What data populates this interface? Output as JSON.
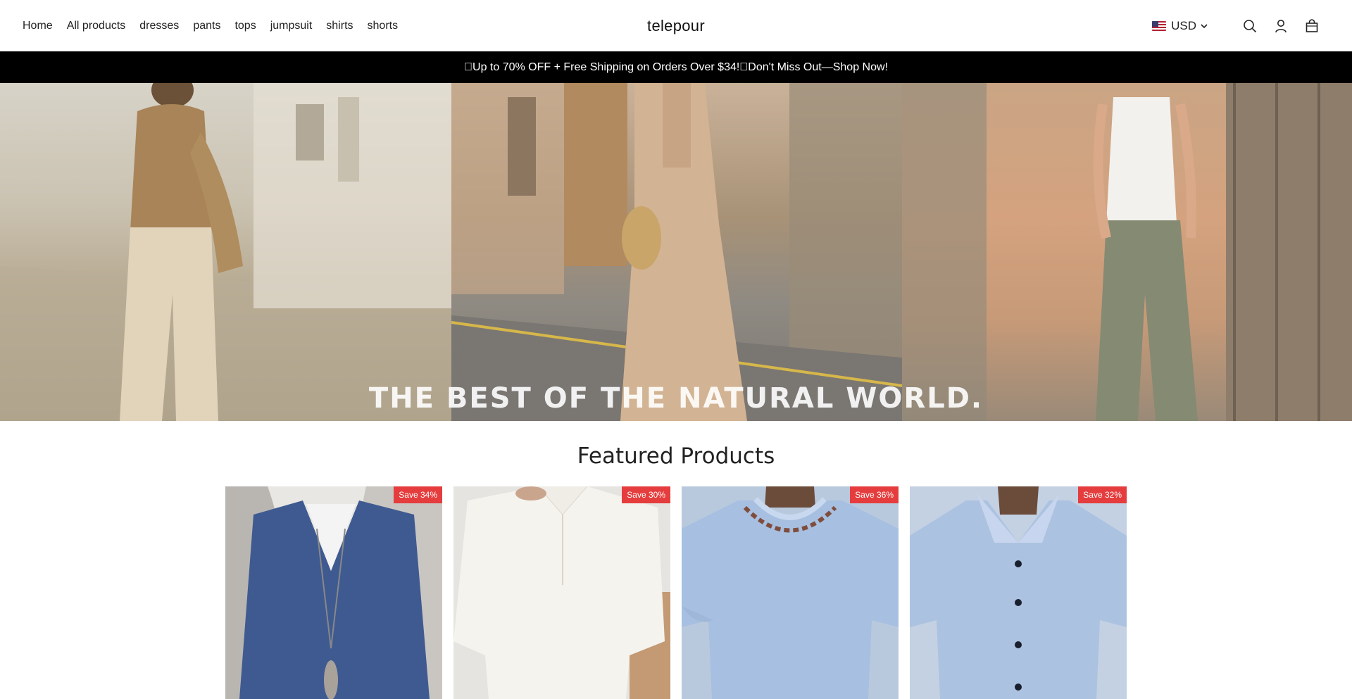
{
  "header": {
    "nav": [
      "Home",
      "All products",
      "dresses",
      "pants",
      "tops",
      "jumpsuit",
      "shirts",
      "shorts"
    ],
    "logo": "telepour",
    "currency": "USD"
  },
  "announcement": "\u0000Up to 70% OFF + Free Shipping on Orders Over $34!\u0000Don't Miss Out—Shop Now!",
  "hero": {
    "headline": "THE BEST OF THE NATURAL WORLD."
  },
  "featured": {
    "title": "Featured Products",
    "products": [
      {
        "badge": "Save 34%"
      },
      {
        "badge": "Save 30%"
      },
      {
        "badge": "Save 36%"
      },
      {
        "badge": "Save 32%"
      }
    ]
  },
  "colors": {
    "announcement_bg": "#000000",
    "badge_bg": "#e53d3d"
  }
}
